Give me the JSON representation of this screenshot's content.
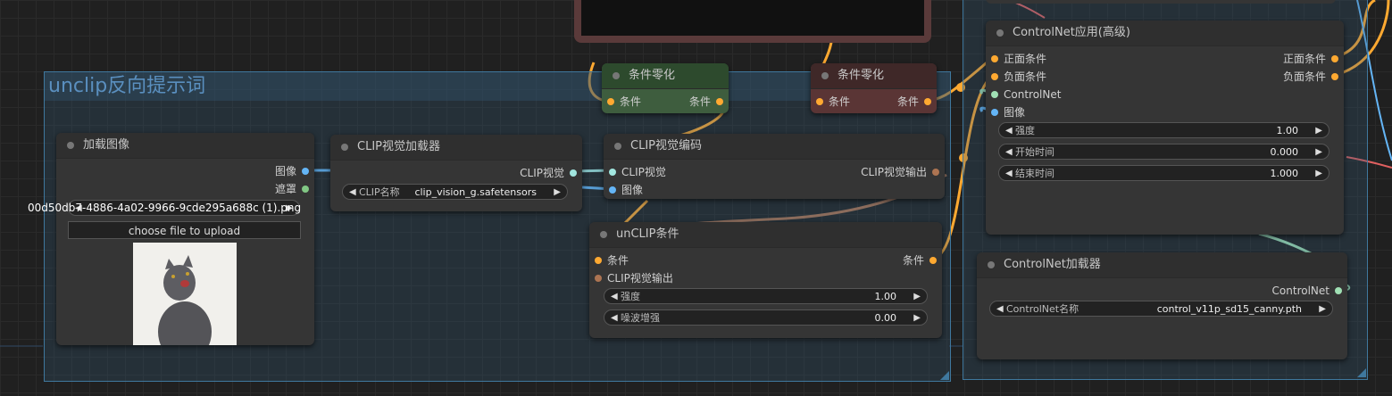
{
  "group": {
    "title": "unclip反向提示词"
  },
  "nodes": {
    "load_image": {
      "title": "加载图像",
      "out_image": "图像",
      "out_mask": "遮罩",
      "filename": "00d50db7-4886-4a02-9966-9cde295a688c (1).png",
      "upload": "choose file to upload"
    },
    "clip_vision_loader": {
      "title": "CLIP视觉加载器",
      "out": "CLIP视觉",
      "widget_label": "CLIP名称",
      "widget_value": "clip_vision_g.safetensors"
    },
    "clip_vision_encode": {
      "title": "CLIP视觉编码",
      "in_clip": "CLIP视觉",
      "in_image": "图像",
      "out": "CLIP视觉输出"
    },
    "unclip": {
      "title": "unCLIP条件",
      "in_cond": "条件",
      "in_cvo": "CLIP视觉输出",
      "out": "条件",
      "w1_label": "强度",
      "w1_value": "1.00",
      "w2_label": "噪波增强",
      "w2_value": "0.00"
    },
    "cond_zero_1": {
      "title": "条件零化",
      "in": "条件",
      "out": "条件"
    },
    "cond_zero_2": {
      "title": "条件零化",
      "in": "条件",
      "out": "条件"
    },
    "controlnet_apply": {
      "title": "ControlNet应用(高级)",
      "in_pos": "正面条件",
      "in_neg": "负面条件",
      "in_cn": "ControlNet",
      "in_img": "图像",
      "out_pos": "正面条件",
      "out_neg": "负面条件",
      "w1_label": "强度",
      "w1_value": "1.00",
      "w2_label": "开始时间",
      "w2_value": "0.000",
      "w3_label": "结束时间",
      "w3_value": "1.000"
    },
    "controlnet_loader": {
      "title": "ControlNet加载器",
      "out": "ControlNet",
      "widget_label": "ControlNet名称",
      "widget_value": "control_v11p_sd15_canny.pth"
    }
  },
  "colors": {
    "cond": "#ffa931",
    "clip_vision": "#a1e6df",
    "image": "#64b5f6",
    "cvo": "#ad7452",
    "controlnet": "#a0e0b4",
    "mask": "#81c784"
  }
}
